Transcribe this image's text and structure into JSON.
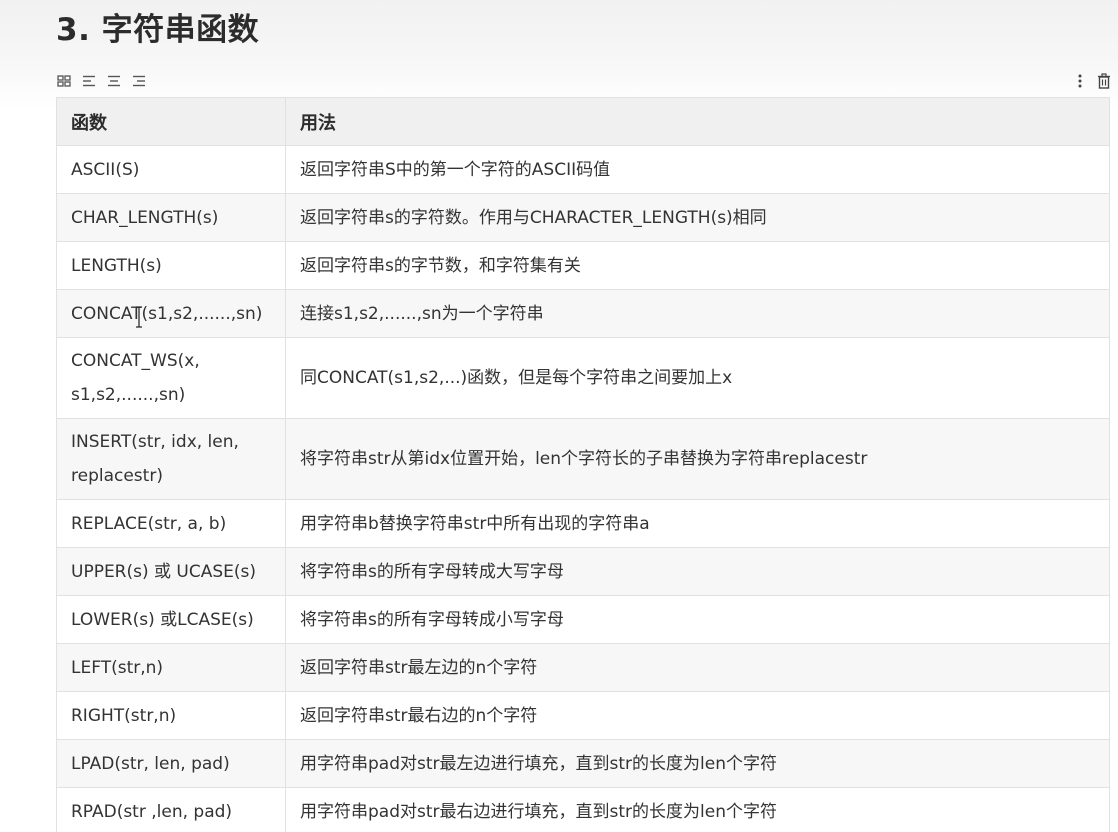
{
  "heading": "3. 字符串函数",
  "toolbar": {
    "left_icons": [
      "table-grid-icon",
      "align-left-icon",
      "align-center-icon",
      "align-right-icon"
    ],
    "right_icons": [
      "more-vertical-icon",
      "trash-icon"
    ]
  },
  "table": {
    "headers": [
      "函数",
      "用法"
    ],
    "rows": [
      [
        "ASCII(S)",
        "返回字符串S中的第一个字符的ASCII码值"
      ],
      [
        "CHAR_LENGTH(s)",
        "返回字符串s的字符数。作用与CHARACTER_LENGTH(s)相同"
      ],
      [
        "LENGTH(s)",
        "返回字符串s的字节数，和字符集有关"
      ],
      [
        "CONCAT(s1,s2,......,sn)",
        "连接s1,s2,......,sn为一个字符串"
      ],
      [
        "CONCAT_WS(x, s1,s2,......,sn)",
        "同CONCAT(s1,s2,...)函数，但是每个字符串之间要加上x"
      ],
      [
        "INSERT(str, idx, len, replacestr)",
        "将字符串str从第idx位置开始，len个字符长的子串替换为字符串replacestr"
      ],
      [
        "REPLACE(str, a, b)",
        "用字符串b替换字符串str中所有出现的字符串a"
      ],
      [
        "UPPER(s) 或 UCASE(s)",
        "将字符串s的所有字母转成大写字母"
      ],
      [
        "LOWER(s)  或LCASE(s)",
        "将字符串s的所有字母转成小写字母"
      ],
      [
        "LEFT(str,n)",
        "返回字符串str最左边的n个字符"
      ],
      [
        "RIGHT(str,n)",
        "返回字符串str最右边的n个字符"
      ],
      [
        "LPAD(str, len, pad)",
        "用字符串pad对str最左边进行填充，直到str的长度为len个字符"
      ],
      [
        "RPAD(str ,len, pad)",
        "用字符串pad对str最右边进行填充，直到str的长度为len个字符"
      ]
    ]
  }
}
